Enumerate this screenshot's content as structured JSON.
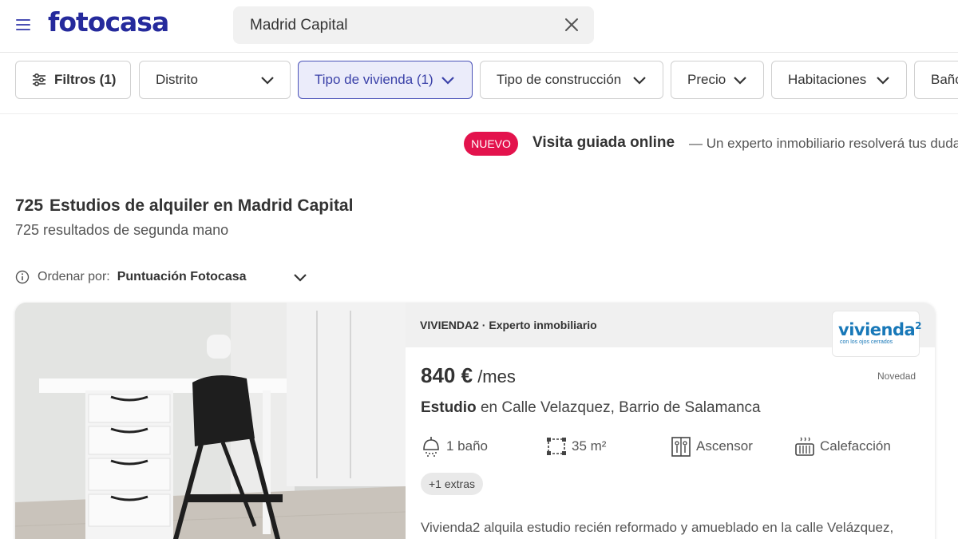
{
  "header": {
    "logo": "fotocasa",
    "search_value": "Madrid Capital"
  },
  "filters": {
    "filtros_label": "Filtros (1)",
    "chips": [
      {
        "label": "Distrito",
        "active": false
      },
      {
        "label": "Tipo de vivienda (1)",
        "active": true
      },
      {
        "label": "Tipo de construcción",
        "active": false
      },
      {
        "label": "Precio",
        "active": false
      },
      {
        "label": "Habitaciones",
        "active": false
      },
      {
        "label": "Baño",
        "active": false
      }
    ]
  },
  "promo": {
    "badge": "NUEVO",
    "title": "Visita guiada online",
    "subtitle": "— Un experto inmobiliario resolverá tus dudas"
  },
  "results": {
    "count": "725",
    "title": "Estudios de alquiler en Madrid Capital",
    "subtitle": "725 resultados de segunda mano"
  },
  "sort": {
    "label": "Ordenar por:",
    "value": "Puntuación Fotocasa"
  },
  "listing": {
    "agency": "VIVIENDA2 · Experto inmobiliario",
    "agency_logo_text": "vivienda",
    "agency_logo_sup": "2",
    "agency_logo_tagline": "con los ojos cerrados",
    "price": "840 €",
    "price_period": " /mes",
    "badge": "Novedad",
    "type": "Estudio",
    "location": " en Calle Velazquez, Barrio de Salamanca",
    "features": [
      {
        "icon": "shower-icon",
        "label": "1 baño"
      },
      {
        "icon": "area-icon",
        "label": "35 m²"
      },
      {
        "icon": "elevator-icon",
        "label": "Ascensor"
      },
      {
        "icon": "heating-icon",
        "label": "Calefacción"
      }
    ],
    "extras": "+1 extras",
    "description": "Vivienda2 alquila estudio recién reformado y amueblado en la calle Velázquez,"
  },
  "colors": {
    "brand": "#252a9c",
    "active_chip_bg": "#ebecfa",
    "active_chip_border": "#4a52b8",
    "nuevo": "#e3134d"
  }
}
